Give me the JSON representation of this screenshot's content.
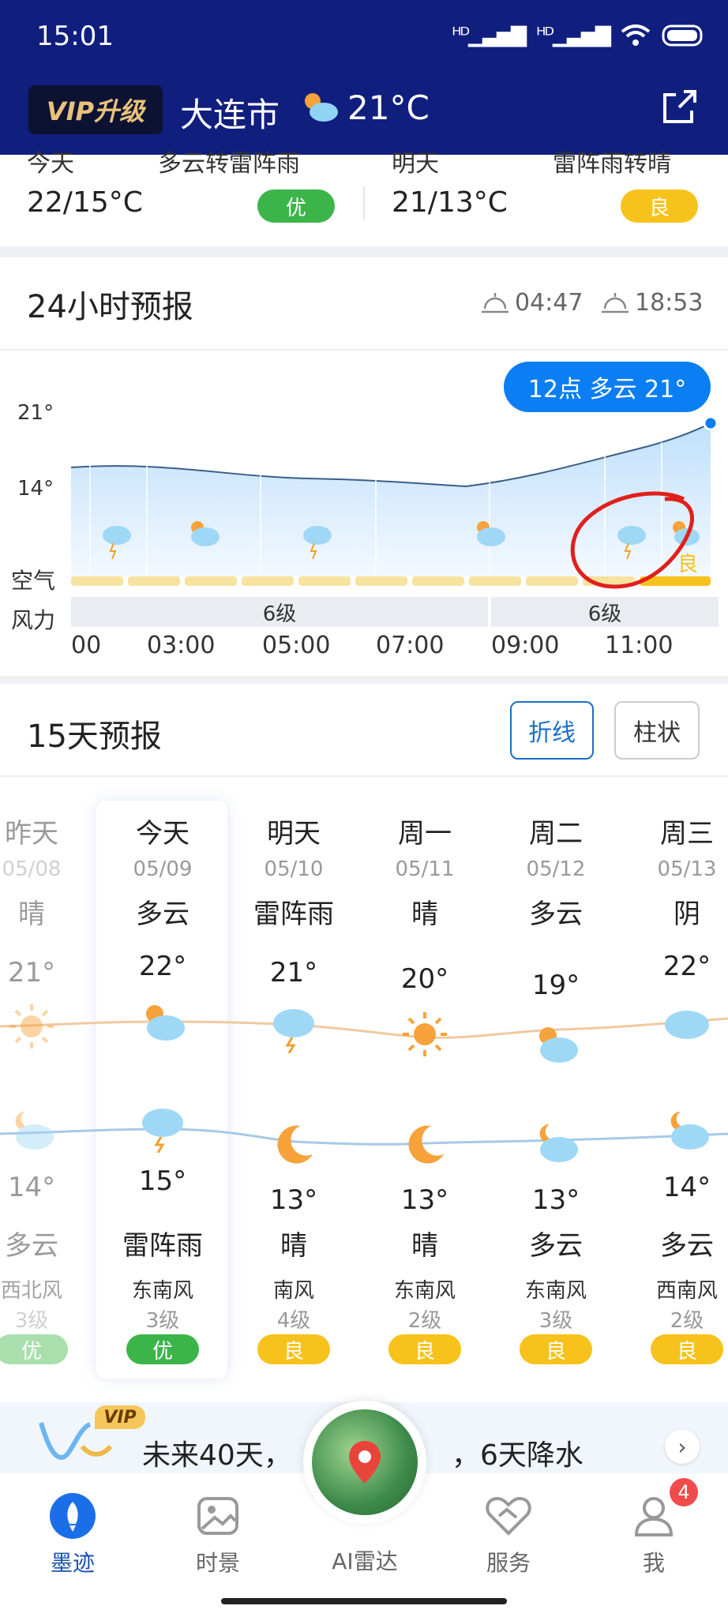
{
  "status_bar": {
    "time": "15:01"
  },
  "header": {
    "vip_label": "VIP升级",
    "city": "大连市",
    "current_temp": "21°C"
  },
  "day_cards": [
    {
      "label_cut": "今天",
      "cond_cut": "多云转雷阵雨",
      "temp": "22/15°C",
      "aqi": "优",
      "aqi_color": "#3bb54a"
    },
    {
      "label_cut": "明天",
      "cond_cut": "雷阵雨转晴",
      "temp": "21/13°C",
      "aqi": "良",
      "aqi_color": "#f7c21b"
    }
  ],
  "hourly": {
    "title": "24小时预报",
    "sunrise": "04:47",
    "sunset": "18:53",
    "tooltip": "12点 多云 21°",
    "y_ticks": [
      "21°",
      "14°"
    ],
    "air_label": "空气",
    "wind_label": "风力",
    "air_last": "良",
    "wind_segments": [
      "6级",
      "6级"
    ],
    "times": [
      "00",
      "03:00",
      "05:00",
      "07:00",
      "09:00",
      "11:00"
    ]
  },
  "daily": {
    "title": "15天预报",
    "toggle_line": "折线",
    "toggle_bar": "柱状",
    "days": [
      {
        "name": "昨天",
        "date": "05/08",
        "day_cond": "晴",
        "high": "21°",
        "low": "14°",
        "night_cond": "多云",
        "wind": "西北风",
        "level": "3级",
        "aqi": "优",
        "day_icon": "sun-icon",
        "night_icon": "cloudy-night-icon"
      },
      {
        "name": "今天",
        "date": "05/09",
        "day_cond": "多云",
        "high": "22°",
        "low": "15°",
        "night_cond": "雷阵雨",
        "wind": "东南风",
        "level": "3级",
        "aqi": "优",
        "day_icon": "partly-cloudy-icon",
        "night_icon": "thunderstorm-icon"
      },
      {
        "name": "明天",
        "date": "05/10",
        "day_cond": "雷阵雨",
        "high": "21°",
        "low": "13°",
        "night_cond": "晴",
        "wind": "南风",
        "level": "4级",
        "aqi": "良",
        "day_icon": "thunderstorm-icon",
        "night_icon": "moon-icon"
      },
      {
        "name": "周一",
        "date": "05/11",
        "day_cond": "晴",
        "high": "20°",
        "low": "13°",
        "night_cond": "晴",
        "wind": "东南风",
        "level": "2级",
        "aqi": "良",
        "day_icon": "sun-icon",
        "night_icon": "moon-icon"
      },
      {
        "name": "周二",
        "date": "05/12",
        "day_cond": "多云",
        "high": "19°",
        "low": "13°",
        "night_cond": "多云",
        "wind": "东南风",
        "level": "3级",
        "aqi": "良",
        "day_icon": "partly-cloudy-icon",
        "night_icon": "cloudy-night-icon"
      },
      {
        "name": "周三",
        "date": "05/13",
        "day_cond": "阴",
        "high": "22°",
        "low": "14°",
        "night_cond": "多云",
        "wind": "西南风",
        "level": "2级",
        "aqi": "良",
        "day_icon": "overcast-icon",
        "night_icon": "cloudy-night-icon"
      }
    ]
  },
  "banner": {
    "vip_tag": "VIP",
    "text_left": "未来40天，",
    "text_right": "，6天降水"
  },
  "nav": {
    "items": [
      "墨迹",
      "时景",
      "AI雷达",
      "服务",
      "我"
    ],
    "badge": "4"
  },
  "colors": {
    "header_bg": "#101f7e",
    "accent_blue": "#0a7ef2",
    "aqi_good": "#3bb54a",
    "aqi_moderate": "#f7c21b",
    "annotation_red": "#e0201c"
  }
}
